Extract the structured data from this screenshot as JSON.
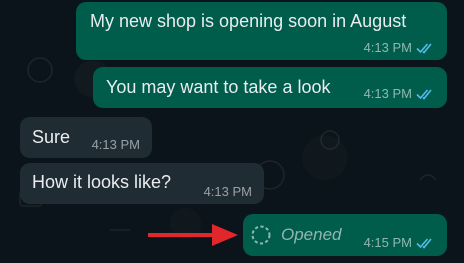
{
  "messages": [
    {
      "text": "My new shop is opening soon in August",
      "time": "4:13 PM",
      "direction": "outgoing",
      "status": "read"
    },
    {
      "text": "You may want to take a look",
      "time": "4:13 PM",
      "direction": "outgoing",
      "status": "read"
    },
    {
      "text": "Sure",
      "time": "4:13 PM",
      "direction": "incoming"
    },
    {
      "text": "How it looks like?",
      "time": "4:13 PM",
      "direction": "incoming"
    },
    {
      "text": "Opened",
      "time": "4:15 PM",
      "direction": "outgoing",
      "status": "read",
      "kind": "view-once-opened"
    }
  ],
  "colors": {
    "background": "#0b141a",
    "outgoing_bubble": "#005c4b",
    "incoming_bubble": "#202c33",
    "read_ticks": "#53bdeb",
    "annotation_arrow": "#e0272b"
  },
  "icons": [
    "double-check-icon",
    "view-once-opened-icon",
    "red-arrow-icon"
  ]
}
